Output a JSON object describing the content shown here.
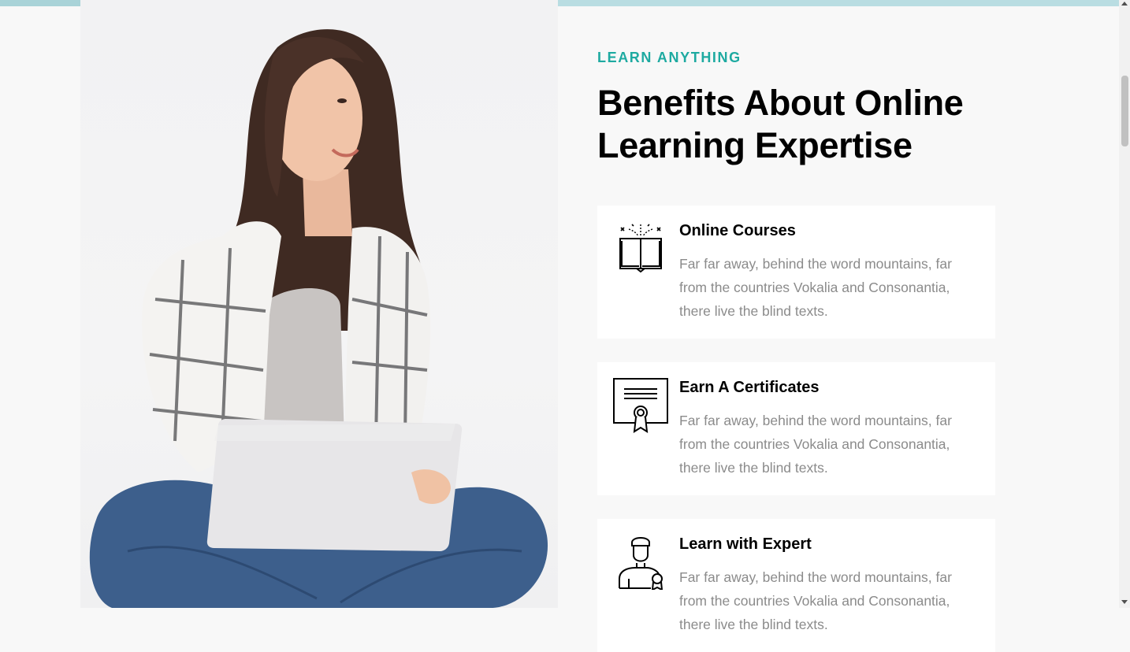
{
  "section": {
    "subheading": "LEARN ANYTHING",
    "heading": "Benefits About Online Learning Expertise"
  },
  "photo": {
    "description_icon": "woman-with-laptop-photo"
  },
  "colors": {
    "accent": "#1eaaa1",
    "top_bar": "#b9dde2",
    "background": "#f8f8f8"
  },
  "features": [
    {
      "icon": "open-book-icon",
      "title": "Online Courses",
      "text": "Far far away, behind the word mountains, far from the countries Vokalia and Consonantia, there live the blind texts."
    },
    {
      "icon": "certificate-icon",
      "title": "Earn A Certificates",
      "text": "Far far away, behind the word mountains, far from the countries Vokalia and Consonantia, there live the blind texts."
    },
    {
      "icon": "expert-icon",
      "title": "Learn with Expert",
      "text": "Far far away, behind the word mountains, far from the countries Vokalia and Consonantia, there live the blind texts."
    }
  ]
}
